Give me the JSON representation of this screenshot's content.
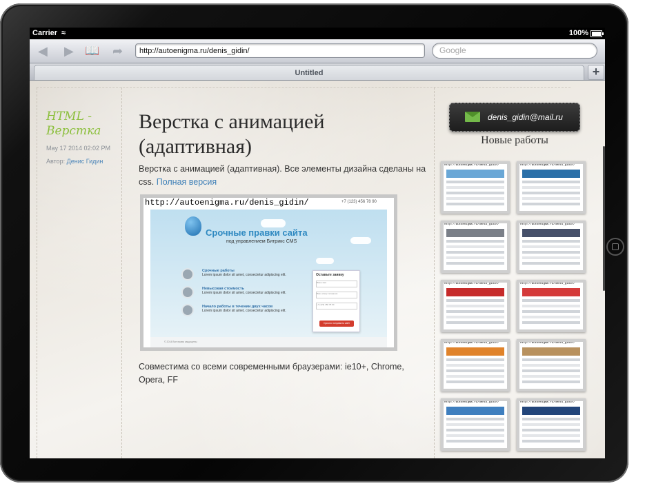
{
  "status": {
    "carrier": "Carrier",
    "battery": "100%"
  },
  "browser": {
    "url": "http://autoenigma.ru/denis_gidin/",
    "search_placeholder": "Google",
    "tab_title": "Untitled",
    "tab_add": "+"
  },
  "icons": {
    "back": "back-arrow-icon",
    "forward": "forward-arrow-icon",
    "bookmarks": "bookmarks-book-icon",
    "share": "share-icon",
    "wifi": "wifi-icon",
    "battery": "battery-icon",
    "email": "envelope-icon"
  },
  "sidebar": {
    "category": "HTML - Верстка",
    "date": "May 17 2014 02:02 PM",
    "author_label": "Автор:",
    "author_name": "Денис Гидин"
  },
  "article": {
    "title": "Верстка с анимацией (адаптивная)",
    "lead": "Верстка с анимацией (адаптивная). Все элементы дизайна сделаны на css.",
    "full_version_link": "Полная версия",
    "compat": "Совместима со всеми современными браузерами: ie10+, Chrome, Opera, FF",
    "preview": {
      "url": "http://autoenigma.ru/denis_gidin/",
      "phone": "+7 (123) 456 78 90",
      "headline": "Срочные правки сайта",
      "subheadline": "под управлением Битрикс CMS",
      "features": [
        {
          "title": "Срочные работы",
          "text": "Lorem ipsum dolor sit amet, consectetur adipiscing elit."
        },
        {
          "title": "Невысокая стоимость",
          "text": "Lorem ipsum dolor sit amet, consectetur adipiscing elit."
        },
        {
          "title": "Начало работы в течении двух часов",
          "text": "Lorem ipsum dolor sit amet, consectetur adipiscing elit."
        }
      ],
      "form_title": "Оставьте заявку",
      "form_fields": [
        "Ваше имя",
        "Ваш номер телефона",
        "+7 (123) 456 78 90"
      ],
      "form_button": "Срочно поправить сайт",
      "footer": "© 2014 Все права защищены"
    }
  },
  "right": {
    "email": "denis_gidin@mail.ru",
    "new_works_title": "Новые работы",
    "thumb_url": "http://autoenigma.ru/denis_gidin/",
    "thumb_colors": [
      "#6aa7d6",
      "#2a6fa8",
      "#7a7f88",
      "#46506a",
      "#c62b2b",
      "#d43a3a",
      "#e0832b",
      "#b8915e",
      "#3f7fbf",
      "#22457a"
    ]
  }
}
